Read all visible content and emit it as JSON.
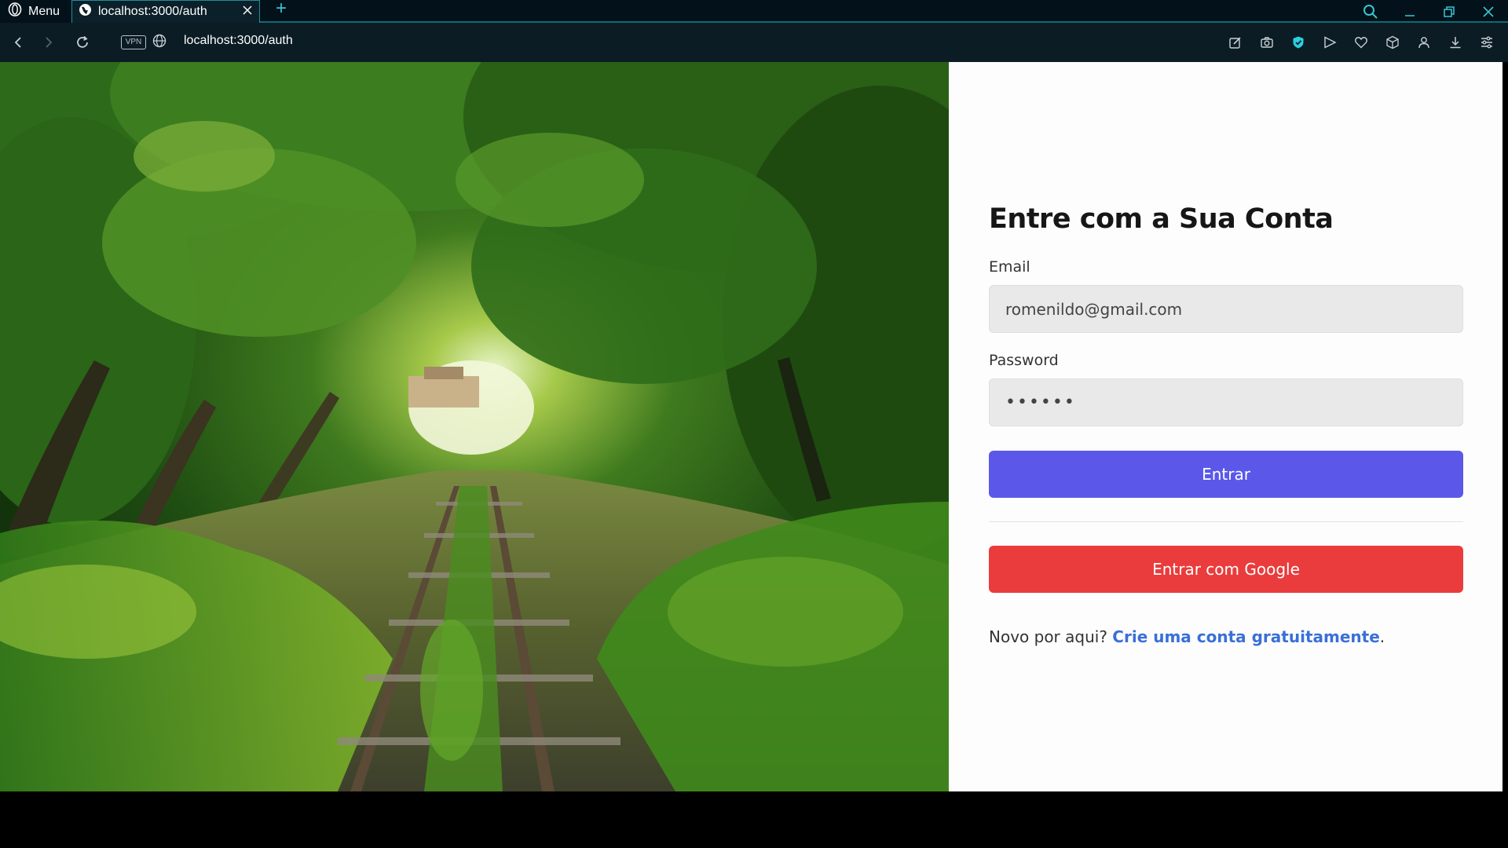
{
  "browser": {
    "menu_label": "Menu",
    "tab_title": "localhost:3000/auth",
    "url": "localhost:3000/auth",
    "vpn_label": "VPN",
    "accent": "#39c4d2"
  },
  "auth": {
    "title": "Entre com a Sua Conta",
    "email_label": "Email",
    "email_value": "romenildo@gmail.com",
    "password_label": "Password",
    "password_value": "••••••",
    "submit_label": "Entrar",
    "google_label": "Entrar com Google",
    "signup_prompt": "Novo por aqui?",
    "signup_link": "Crie uma conta gratuitamente",
    "signup_suffix": "."
  },
  "colors": {
    "primary_button": "#5b58e9",
    "google_button": "#ea3c3c",
    "link": "#3a6fd8"
  },
  "icons": {
    "menu": "opera-logo-icon",
    "tab": "globe-icon",
    "nav": [
      "back-icon",
      "forward-icon",
      "reload-icon"
    ],
    "extensions": [
      "snapshot-edit-icon",
      "camera-icon",
      "shield-icon",
      "send-icon",
      "heart-icon",
      "cube-icon",
      "profile-icon",
      "download-icon",
      "easy-setup-icon"
    ]
  }
}
